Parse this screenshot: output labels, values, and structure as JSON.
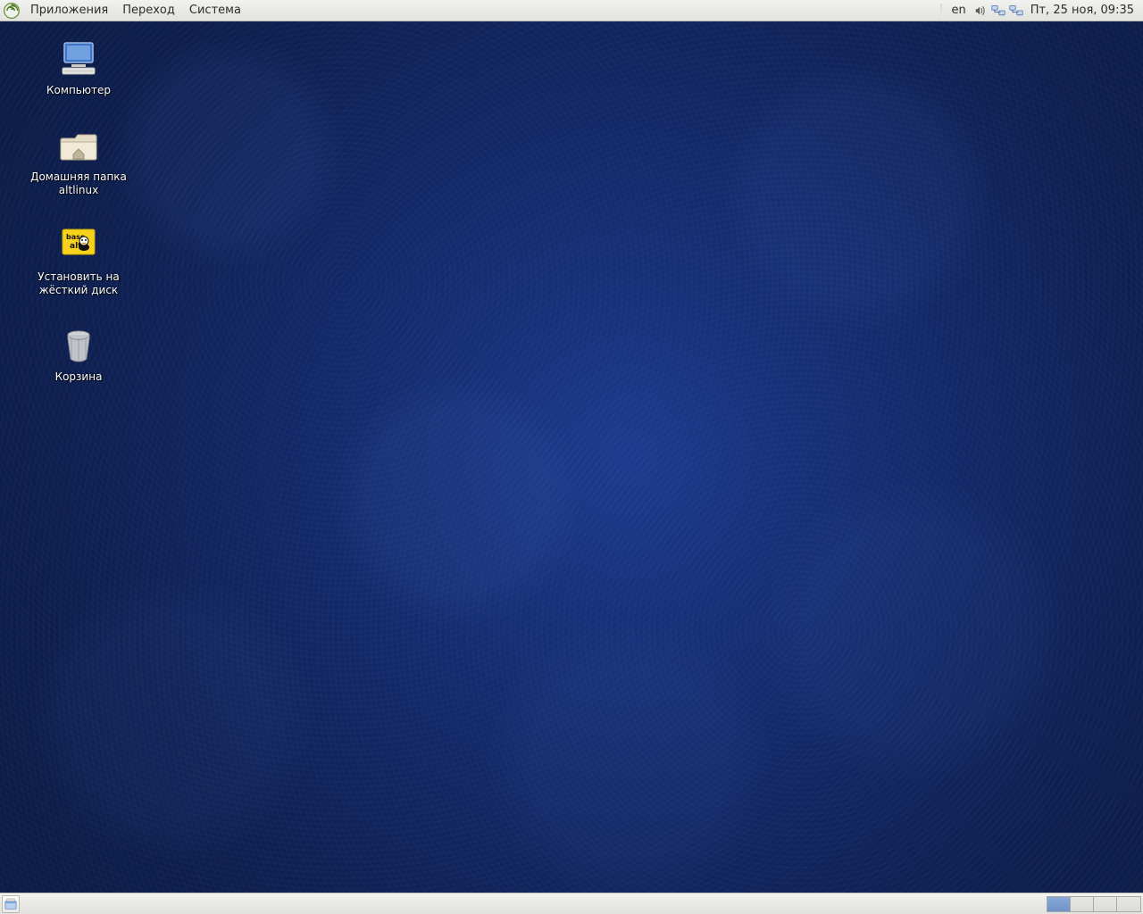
{
  "top_panel": {
    "menus": [
      "Приложения",
      "Переход",
      "Система"
    ],
    "tray": {
      "keyboard_layout": "en",
      "datetime": "Пт, 25 ноя, 09:35"
    }
  },
  "desktop_icons": [
    {
      "id": "computer",
      "label": "Компьютер",
      "icon": "computer-icon"
    },
    {
      "id": "home",
      "label": "Домашняя папка\naltlinux",
      "icon": "home-folder-icon"
    },
    {
      "id": "installer",
      "label": "Установить на\nжёсткий диск",
      "icon": "basealt-installer-icon"
    },
    {
      "id": "trash",
      "label": "Корзина",
      "icon": "trash-icon"
    }
  ],
  "bottom_panel": {
    "workspaces": {
      "count": 4,
      "active": 0
    }
  },
  "colors": {
    "panel_bg": "#e9e9e6",
    "wallpaper_center": "#1c3a8e",
    "wallpaper_edge": "#0b1b45",
    "accent": "#6f92c8"
  }
}
